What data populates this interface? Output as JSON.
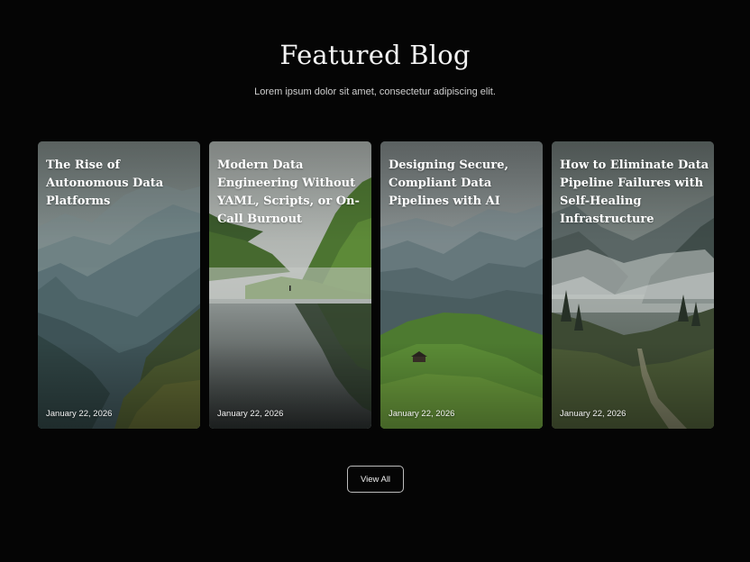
{
  "header": {
    "title": "Featured Blog",
    "subtitle": "Lorem ipsum dolor sit amet, consectetur adipiscing elit."
  },
  "posts": [
    {
      "title": "The Rise of Autonomous Data Platforms",
      "date": "January 22, 2026"
    },
    {
      "title": "Modern Data Engineering Without YAML, Scripts, or On-Call Burnout",
      "date": "January 22, 2026"
    },
    {
      "title": "Designing Secure, Compliant Data Pipelines with AI",
      "date": "January 22, 2026"
    },
    {
      "title": "How to Eliminate Data Pipeline Failures with Self-Healing Infrastructure",
      "date": "January 22, 2026"
    }
  ],
  "actions": {
    "view_all_label": "View All"
  },
  "colors": {
    "background": "#050505",
    "card_overlay_text": "#ffffff",
    "button_border": "#bdbdbd"
  }
}
